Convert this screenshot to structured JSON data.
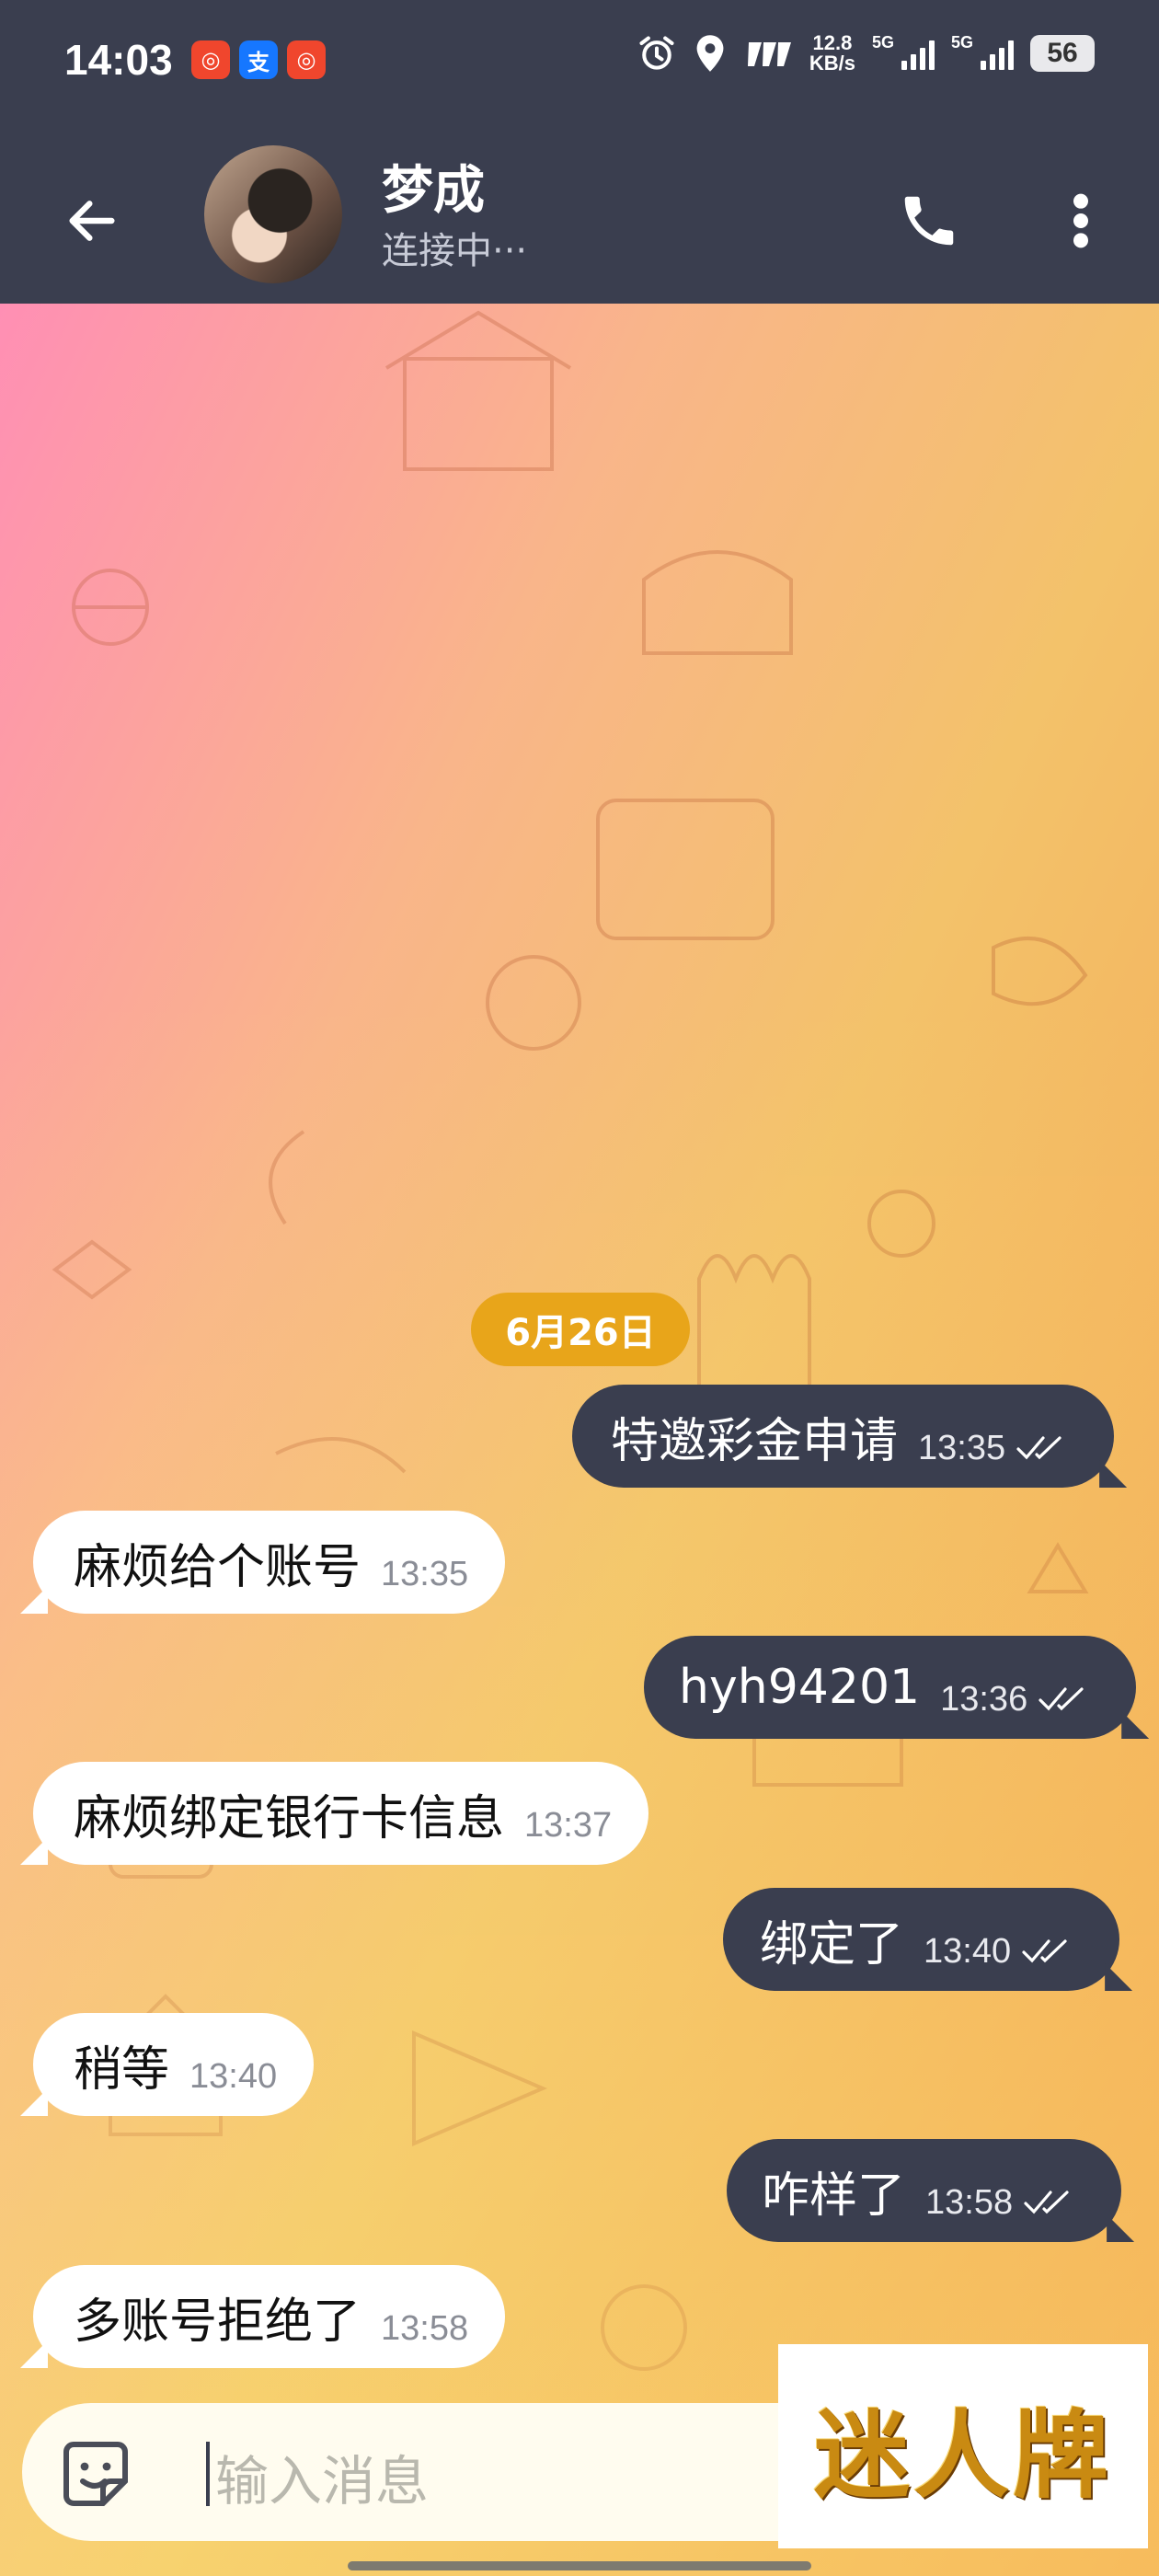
{
  "status_bar": {
    "time": "14:03",
    "app_icons": [
      "app-icon-red",
      "alipay-icon",
      "app-icon-red-2"
    ],
    "speed_value": "12.8",
    "speed_unit": "KB/s",
    "network_1": "5G",
    "network_2": "5G",
    "battery": "56"
  },
  "header": {
    "contact_name": "梦成",
    "status": "连接中···"
  },
  "chat": {
    "date_chip": "6月26日",
    "messages": [
      {
        "dir": "out",
        "text": "特邀彩金申请",
        "time": "13:35"
      },
      {
        "dir": "in",
        "text": "麻烦给个账号",
        "time": "13:35"
      },
      {
        "dir": "out",
        "text": "hyh94201",
        "time": "13:36"
      },
      {
        "dir": "in",
        "text": "麻烦绑定银行卡信息",
        "time": "13:37"
      },
      {
        "dir": "out",
        "text": "绑定了",
        "time": "13:40"
      },
      {
        "dir": "in",
        "text": "稍等",
        "time": "13:40"
      },
      {
        "dir": "out",
        "text": "咋样了",
        "time": "13:58"
      },
      {
        "dir": "in",
        "text": "多账号拒绝了",
        "time": "13:58"
      }
    ]
  },
  "input": {
    "placeholder": "输入消息"
  },
  "watermark": {
    "text": "迷人牌"
  },
  "colors": {
    "header_bg": "#3a3e4f",
    "outgoing_bubble": "#3a3e4f",
    "incoming_bubble": "#ffffff",
    "date_chip": "#e8a51a"
  }
}
